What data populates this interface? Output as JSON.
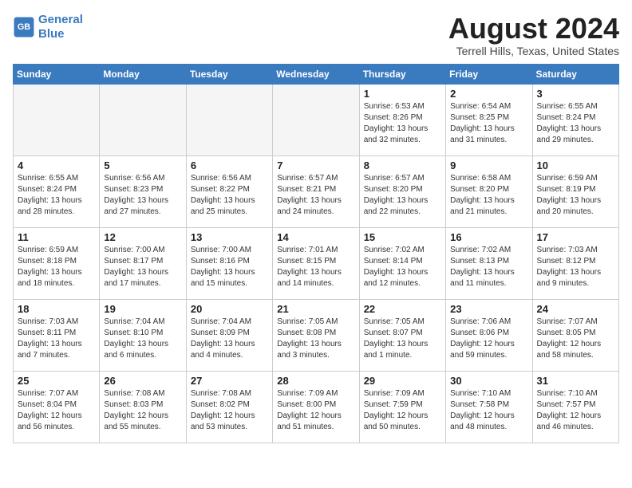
{
  "header": {
    "logo_line1": "General",
    "logo_line2": "Blue",
    "month": "August 2024",
    "location": "Terrell Hills, Texas, United States"
  },
  "days_of_week": [
    "Sunday",
    "Monday",
    "Tuesday",
    "Wednesday",
    "Thursday",
    "Friday",
    "Saturday"
  ],
  "weeks": [
    [
      {
        "day": "",
        "info": ""
      },
      {
        "day": "",
        "info": ""
      },
      {
        "day": "",
        "info": ""
      },
      {
        "day": "",
        "info": ""
      },
      {
        "day": "1",
        "info": "Sunrise: 6:53 AM\nSunset: 8:26 PM\nDaylight: 13 hours\nand 32 minutes."
      },
      {
        "day": "2",
        "info": "Sunrise: 6:54 AM\nSunset: 8:25 PM\nDaylight: 13 hours\nand 31 minutes."
      },
      {
        "day": "3",
        "info": "Sunrise: 6:55 AM\nSunset: 8:24 PM\nDaylight: 13 hours\nand 29 minutes."
      }
    ],
    [
      {
        "day": "4",
        "info": "Sunrise: 6:55 AM\nSunset: 8:24 PM\nDaylight: 13 hours\nand 28 minutes."
      },
      {
        "day": "5",
        "info": "Sunrise: 6:56 AM\nSunset: 8:23 PM\nDaylight: 13 hours\nand 27 minutes."
      },
      {
        "day": "6",
        "info": "Sunrise: 6:56 AM\nSunset: 8:22 PM\nDaylight: 13 hours\nand 25 minutes."
      },
      {
        "day": "7",
        "info": "Sunrise: 6:57 AM\nSunset: 8:21 PM\nDaylight: 13 hours\nand 24 minutes."
      },
      {
        "day": "8",
        "info": "Sunrise: 6:57 AM\nSunset: 8:20 PM\nDaylight: 13 hours\nand 22 minutes."
      },
      {
        "day": "9",
        "info": "Sunrise: 6:58 AM\nSunset: 8:20 PM\nDaylight: 13 hours\nand 21 minutes."
      },
      {
        "day": "10",
        "info": "Sunrise: 6:59 AM\nSunset: 8:19 PM\nDaylight: 13 hours\nand 20 minutes."
      }
    ],
    [
      {
        "day": "11",
        "info": "Sunrise: 6:59 AM\nSunset: 8:18 PM\nDaylight: 13 hours\nand 18 minutes."
      },
      {
        "day": "12",
        "info": "Sunrise: 7:00 AM\nSunset: 8:17 PM\nDaylight: 13 hours\nand 17 minutes."
      },
      {
        "day": "13",
        "info": "Sunrise: 7:00 AM\nSunset: 8:16 PM\nDaylight: 13 hours\nand 15 minutes."
      },
      {
        "day": "14",
        "info": "Sunrise: 7:01 AM\nSunset: 8:15 PM\nDaylight: 13 hours\nand 14 minutes."
      },
      {
        "day": "15",
        "info": "Sunrise: 7:02 AM\nSunset: 8:14 PM\nDaylight: 13 hours\nand 12 minutes."
      },
      {
        "day": "16",
        "info": "Sunrise: 7:02 AM\nSunset: 8:13 PM\nDaylight: 13 hours\nand 11 minutes."
      },
      {
        "day": "17",
        "info": "Sunrise: 7:03 AM\nSunset: 8:12 PM\nDaylight: 13 hours\nand 9 minutes."
      }
    ],
    [
      {
        "day": "18",
        "info": "Sunrise: 7:03 AM\nSunset: 8:11 PM\nDaylight: 13 hours\nand 7 minutes."
      },
      {
        "day": "19",
        "info": "Sunrise: 7:04 AM\nSunset: 8:10 PM\nDaylight: 13 hours\nand 6 minutes."
      },
      {
        "day": "20",
        "info": "Sunrise: 7:04 AM\nSunset: 8:09 PM\nDaylight: 13 hours\nand 4 minutes."
      },
      {
        "day": "21",
        "info": "Sunrise: 7:05 AM\nSunset: 8:08 PM\nDaylight: 13 hours\nand 3 minutes."
      },
      {
        "day": "22",
        "info": "Sunrise: 7:05 AM\nSunset: 8:07 PM\nDaylight: 13 hours\nand 1 minute."
      },
      {
        "day": "23",
        "info": "Sunrise: 7:06 AM\nSunset: 8:06 PM\nDaylight: 12 hours\nand 59 minutes."
      },
      {
        "day": "24",
        "info": "Sunrise: 7:07 AM\nSunset: 8:05 PM\nDaylight: 12 hours\nand 58 minutes."
      }
    ],
    [
      {
        "day": "25",
        "info": "Sunrise: 7:07 AM\nSunset: 8:04 PM\nDaylight: 12 hours\nand 56 minutes."
      },
      {
        "day": "26",
        "info": "Sunrise: 7:08 AM\nSunset: 8:03 PM\nDaylight: 12 hours\nand 55 minutes."
      },
      {
        "day": "27",
        "info": "Sunrise: 7:08 AM\nSunset: 8:02 PM\nDaylight: 12 hours\nand 53 minutes."
      },
      {
        "day": "28",
        "info": "Sunrise: 7:09 AM\nSunset: 8:00 PM\nDaylight: 12 hours\nand 51 minutes."
      },
      {
        "day": "29",
        "info": "Sunrise: 7:09 AM\nSunset: 7:59 PM\nDaylight: 12 hours\nand 50 minutes."
      },
      {
        "day": "30",
        "info": "Sunrise: 7:10 AM\nSunset: 7:58 PM\nDaylight: 12 hours\nand 48 minutes."
      },
      {
        "day": "31",
        "info": "Sunrise: 7:10 AM\nSunset: 7:57 PM\nDaylight: 12 hours\nand 46 minutes."
      }
    ]
  ]
}
